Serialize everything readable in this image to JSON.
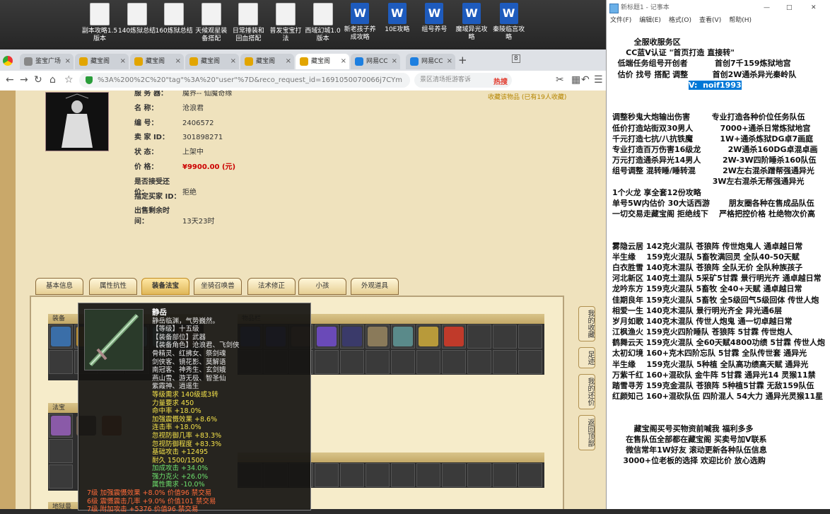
{
  "desktop": {
    "icons": [
      {
        "label": "副本攻略1.5\n版本",
        "type": "txt"
      },
      {
        "label": "140炼狱总结",
        "type": "txt"
      },
      {
        "label": "160炼狱总结",
        "type": "txt"
      },
      {
        "label": "天候观星装\n备搭配",
        "type": "txt"
      },
      {
        "label": "日常捶装和\n回血搭配",
        "type": "txt"
      },
      {
        "label": "普发宝宝打\n法",
        "type": "txt"
      },
      {
        "label": "西域幻城1.0\n版本",
        "type": "txt"
      },
      {
        "label": "新老孩子养\n成攻略",
        "type": "word"
      },
      {
        "label": "10E攻略",
        "type": "word"
      },
      {
        "label": "组号养号",
        "type": "word"
      },
      {
        "label": "魔域异光攻\n略",
        "type": "word"
      },
      {
        "label": "秦陵临宫攻\n略",
        "type": "word"
      }
    ]
  },
  "browser": {
    "tabs": [
      {
        "label": "鉴宝广场",
        "active": false
      },
      {
        "label": "藏宝阁",
        "active": false
      },
      {
        "label": "藏宝阁",
        "active": false
      },
      {
        "label": "藏宝阁",
        "active": false
      },
      {
        "label": "藏宝阁",
        "active": false
      },
      {
        "label": "藏宝阁",
        "active": true
      },
      {
        "label": "网易CC",
        "active": false
      },
      {
        "label": "网易CC",
        "active": false
      }
    ],
    "tab_badge": "8",
    "url": "%3A%200%2C%20\"tag\"%3A%20\"user\"%7D&reco_request_id=1691050070066j7CYm",
    "search_placeholder": "景区清场拒游客诉",
    "search_hot": "热搜"
  },
  "listing": {
    "rows": [
      {
        "label": "服 务 器：",
        "value": "魔界-- 仙魔奇缘"
      },
      {
        "label": "名        称：",
        "value": "沧浪君"
      },
      {
        "label": "编        号：",
        "value": "2406572"
      },
      {
        "label": "卖   家  ID：",
        "value": "301898271"
      },
      {
        "label": "状        态：",
        "value": "上架中"
      },
      {
        "label": "价        格：",
        "value": "¥9900.00 (元)",
        "price": true
      },
      {
        "label": "是否接受还价：",
        "value": "拒绝"
      },
      {
        "label": "指定买家 ID：",
        "value": ""
      },
      {
        "label": "出售剩余时间：",
        "value": "13天23时"
      }
    ],
    "favorite": "收藏该物品 (已有19人收藏)",
    "tabs": [
      "基本信息",
      "属性抗性",
      "装备法宝",
      "坐骑召唤兽",
      "法术修正",
      "小孩",
      "外观道具"
    ],
    "active_tab": "装备法宝",
    "sections": {
      "equipment": "装备",
      "inventory": "物品栏",
      "treasure": "法宝",
      "land": "地狱曼"
    }
  },
  "side_tabs": [
    "我的收藏",
    "足迹",
    "我的还价",
    "返回顶部"
  ],
  "tooltip": {
    "name": "静岳",
    "lines": [
      {
        "t": "静岳临渊，气势巍然。",
        "c": ""
      },
      {
        "t": "【等级】十五级",
        "c": ""
      },
      {
        "t": "【装备部位】武器",
        "c": ""
      },
      {
        "t": "【装备角色】沧浪君、飞剑侠",
        "c": ""
      },
      {
        "t": "骨精灵、红拂女、祭剑魂",
        "c": ""
      },
      {
        "t": "剑侠客、镜花影、莫解语",
        "c": ""
      },
      {
        "t": "南冠客、神秀生、玄剑娥",
        "c": ""
      },
      {
        "t": "燕山雪、游无极、智圣仙",
        "c": ""
      },
      {
        "t": "紫霞神、逍遥生",
        "c": ""
      },
      {
        "t": "等级需求 140级或3转",
        "c": "y"
      },
      {
        "t": "力量要求 450",
        "c": "y"
      },
      {
        "t": "命中率 +18.0%",
        "c": "y"
      },
      {
        "t": "加强震慑效果 +8.6%",
        "c": "y"
      },
      {
        "t": "连击率 +18.0%",
        "c": "y"
      },
      {
        "t": "忽视防御几率 +83.3%",
        "c": "y"
      },
      {
        "t": "忽视防御程度 +83.3%",
        "c": "y"
      },
      {
        "t": "基础攻击 +12495",
        "c": "y"
      },
      {
        "t": "耐久 1500/1500",
        "c": "y"
      },
      {
        "t": "加成攻击 +34.0%",
        "c": "g"
      },
      {
        "t": "强力克火 +26.0%",
        "c": "g"
      },
      {
        "t": "属性需求 -10.0%",
        "c": "g"
      },
      {
        "t": "7级 加强震慑效果 +8.0% 价值96 禁交易",
        "c": "r"
      },
      {
        "t": "6级 震慑震击几率 +9.0% 价值101 禁交易",
        "c": "r"
      },
      {
        "t": "7级 附加攻击 +5376 价值96 禁交易",
        "c": "r"
      }
    ]
  },
  "notepad": {
    "title": "新标题1 - 记事本",
    "menu": [
      "文件(F)",
      "编辑(E)",
      "格式(O)",
      "查看(V)",
      "帮助(H)"
    ],
    "selected_line": "V:  noif1993",
    "lines": [
      "        全服收服务区",
      "     CC蓝V认证 \"首页打造 直接转\"",
      "  低端任务组号开创者          首创7千159炼狱地宫",
      "  估价 找号 搭配 调整         首创2W通杀异光秦岭队",
      "",
      "",
      "调整秒鬼大炮输出伤害        专业打造各种价位任务队伍",
      "低价打造站街双30男人          7000+通杀日常炼狱地宫",
      "千元打造七抗/八抗铁魔          1W+通杀炼狱DG卓7画庭",
      "专业打造百万伤害16级龙          2W通杀160DG卓混卓画",
      "万元打造通杀异光14男人        2W-3W四阶睡杀160队伍",
      "组号调整 混转睡/睡转混          2W左右混杀蹭帮强通异光",
      "                                     3W左右混杀无帮强通异光",
      "1个火龙 享全套12份攻略",
      "单号5W内估价 30大话西游       朋友圈各种在售成品队伍",
      "一切交易走藏宝阁 拒绝线下    严格把控价格 杜绝物次价高",
      "",
      "",
      "雾隐云居 142克火混队 苍狼阵 传世炮鬼人 通卓越日常",
      "半生缘    159克火混队 5畜牧满回灵 全队40-50天赋",
      "白衣胜雪 140克木混队 苍狼阵 全队无价 全队种族孩子",
      "河北新区 140克土混队 5采矿5甘霖 景行明光齐 通卓越日常",
      "龙吟东方 159克火混队 5畜牧 全40+天赋 通卓越日常",
      "佳期良年 159克火混队 5畜牧 全5级回气5级回体 传世人炮",
      "相爱一生 140克木混队 景行明光齐全 异光通6层",
      "岁月如歌 140克木混队 传世人炮鬼 通一切卓越日常",
      "江枫渔火 159克火四阶睡队 苍狼阵 5甘霖 传世炮人",
      "鹤舞云天 159克火混队 全60天赋4800功绩 5甘霖 传世人炮",
      "太初幻境 160+克木四阶忘队 5甘霖 全队传世套 通异光",
      "半生缘    159克火混队 5种植 全队高功绩高天赋 通异光",
      "万紫千红 160+混砍队 金牛阵 5甘霖 通异光14 灵猴11禁",
      "踏雪寻芳 159克金混队 苍狼阵 5种植5甘霖 无敌159队伍",
      "红颜知己 160+混砍队伍 四阶混人 54大力 通异光灵猴11星",
      "",
      "",
      "        藏宝阁买号买物资前喊我 福利多多",
      "     在售队伍全部都在藏宝阁 买卖号加V联系",
      "     微信常年1W好友 滚动更新各种队伍信息",
      "    3000+位老板的选择 欢迎比价 放心选购"
    ]
  }
}
